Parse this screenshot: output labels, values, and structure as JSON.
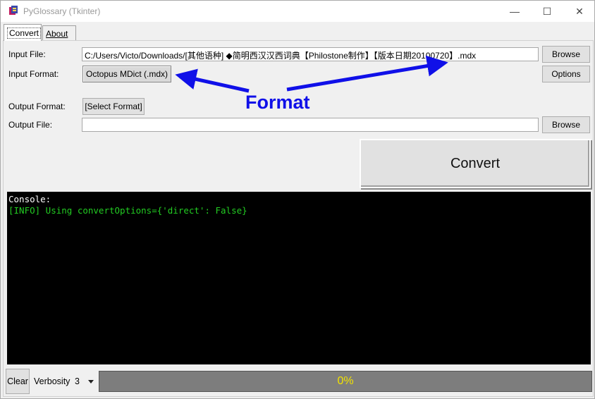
{
  "window": {
    "title": "PyGlossary (Tkinter)",
    "controls": {
      "minimize": "—",
      "maximize": "☐",
      "close": "✕"
    }
  },
  "tabs": [
    {
      "label": "Convert",
      "active": true
    },
    {
      "label": "About",
      "active": false
    }
  ],
  "form": {
    "input_file_label": "Input File:",
    "input_file_value": "C:/Users/Victo/Downloads/[其他语种] ◆简明西汉汉西词典【Philostone制作】【版本日期20100720】.mdx",
    "input_browse": "Browse",
    "input_format_label": "Input Format:",
    "input_format_value": "Octopus MDict (.mdx)",
    "options_button": "Options",
    "output_format_label": "Output Format:",
    "output_format_value": "[Select Format]",
    "output_file_label": "Output File:",
    "output_file_value": "",
    "output_browse": "Browse",
    "convert_button": "Convert"
  },
  "console": {
    "lines": [
      {
        "text": "Console:",
        "color": "#ffffff"
      },
      {
        "text": "[INFO] Using convertOptions={'direct': False}",
        "color": "#22cc22"
      }
    ]
  },
  "bottom": {
    "clear_button": "Clear",
    "verbosity_label": "Verbosity",
    "verbosity_value": "3",
    "progress_text": "0%",
    "progress_fraction": 0
  },
  "annotation": {
    "text": "Format",
    "color": "#1010e8"
  }
}
